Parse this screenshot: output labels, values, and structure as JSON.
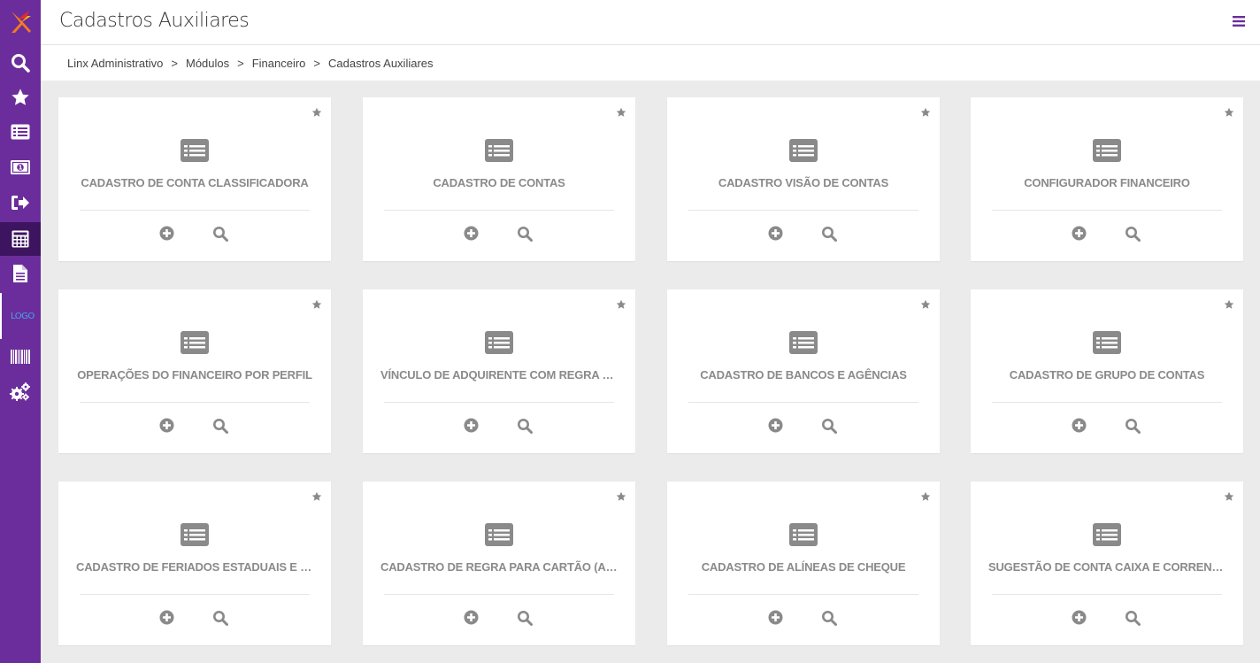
{
  "header": {
    "title": "Cadastros Auxiliares",
    "menu_icon": "hamburger-icon"
  },
  "breadcrumb": [
    {
      "label": "Linx Administrativo"
    },
    {
      "label": "Módulos"
    },
    {
      "label": "Financeiro"
    },
    {
      "label": "Cadastros Auxiliares"
    }
  ],
  "breadcrumb_separator": ">",
  "sidebar": {
    "items": [
      {
        "icon": "search-icon"
      },
      {
        "icon": "star-icon"
      },
      {
        "icon": "list-icon"
      },
      {
        "icon": "money-icon"
      },
      {
        "icon": "sign-out-icon"
      },
      {
        "icon": "calculator-icon",
        "active": true
      },
      {
        "icon": "document-icon"
      },
      {
        "icon": "broken-image-icon",
        "label": "LOGO"
      },
      {
        "icon": "barcode-icon"
      },
      {
        "icon": "cogs-icon"
      }
    ]
  },
  "colors": {
    "sidebar_bg": "#6b2d9b",
    "sidebar_active": "#3d1460",
    "accent": "#6b2d9b",
    "card_text": "#8a8a8a"
  },
  "cards": [
    {
      "title": "CADASTRO DE CONTA CLASSIFICADORA"
    },
    {
      "title": "CADASTRO DE CONTAS"
    },
    {
      "title": "CADASTRO VISÃO DE CONTAS"
    },
    {
      "title": "CONFIGURADOR FINANCEIRO"
    },
    {
      "title": "OPERAÇÕES DO FINANCEIRO POR PERFIL"
    },
    {
      "title": "VÍNCULO DE ADQUIRENTE COM REGRA DE C..."
    },
    {
      "title": "CADASTRO DE BANCOS E AGÊNCIAS"
    },
    {
      "title": "CADASTRO DE GRUPO DE CONTAS"
    },
    {
      "title": "CADASTRO DE FERIADOS ESTADUAIS E MUN..."
    },
    {
      "title": "CADASTRO DE REGRA PARA CARTÃO (ADM)"
    },
    {
      "title": "CADASTRO DE ALÍNEAS DE CHEQUE"
    },
    {
      "title": "SUGESTÃO DE CONTA CAIXA E CORRENTE"
    }
  ]
}
